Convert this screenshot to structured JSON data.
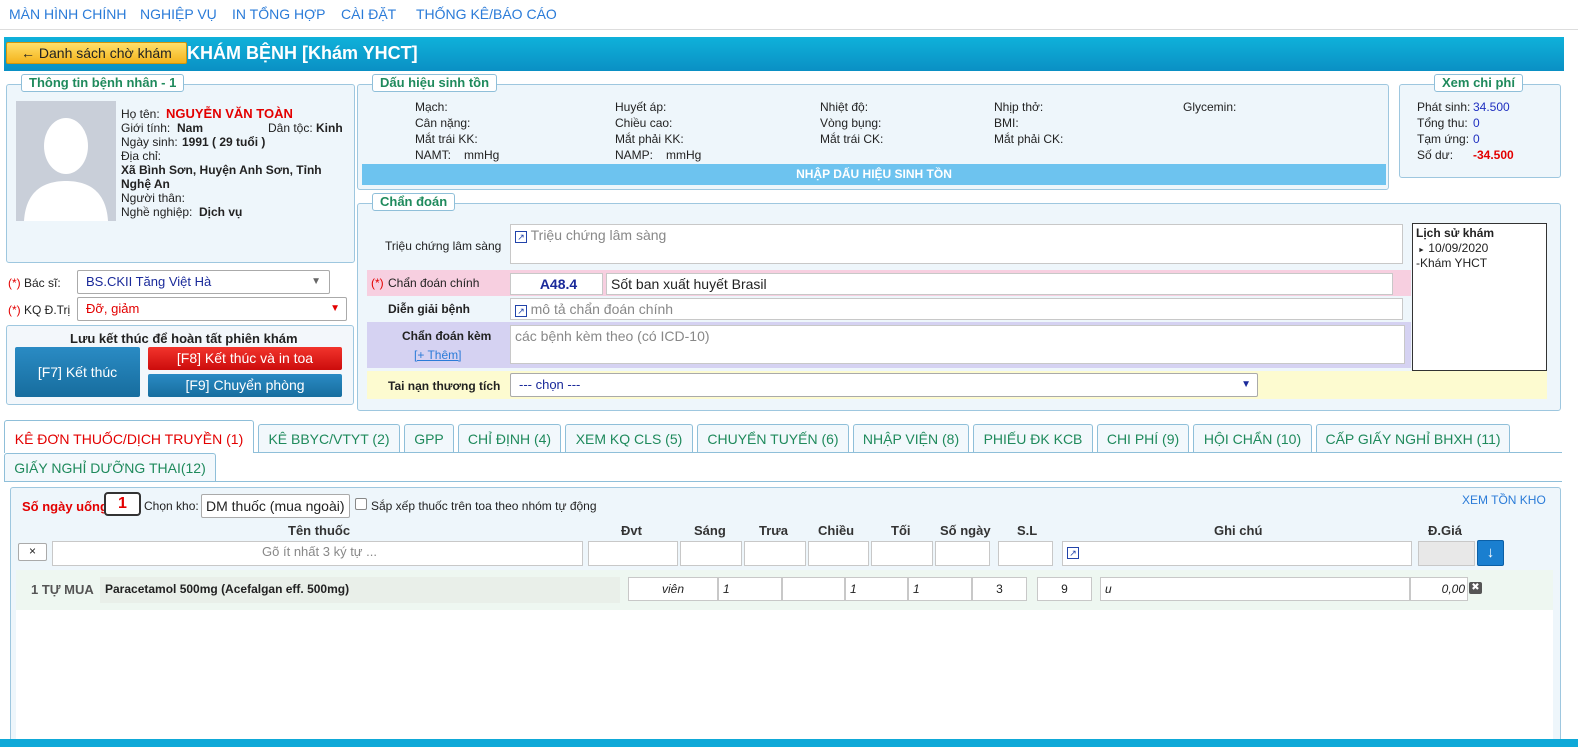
{
  "nav": [
    "MÀN HÌNH CHÍNH",
    "NGHIỆP VỤ",
    "IN TỔNG HỢP",
    "CÀI ĐẶT",
    "THỐNG KÊ/BÁO CÁO"
  ],
  "header": {
    "back_label": "← Danh sách chờ khám",
    "title": "KHÁM BỆNH [Khám YHCT]"
  },
  "patient": {
    "legend": "Thông tin bệnh nhân - 1",
    "name_label": "Họ tên:",
    "name": "NGUYỄN VĂN TOÀN",
    "gender_label": "Giới tính:",
    "gender": "Nam",
    "ethnic_label": "Dân tộc:",
    "ethnic": "Kinh",
    "dob_label": "Ngày sinh:",
    "dob": "1991 ( 29 tuổi )",
    "address_label": "Địa chỉ:",
    "address_line1": "Xã Bình Sơn, Huyện Anh Sơn, Tỉnh",
    "address_line2": "Nghệ An",
    "relative_label": "Người thân:",
    "job_label": "Nghề nghiệp:",
    "job": "Dịch vụ"
  },
  "doctor": {
    "required": "(*)",
    "label": "Bác sĩ:",
    "value": "BS.CKII Tăng Việt Hà"
  },
  "result": {
    "required": "(*)",
    "label": "KQ Đ.Trị",
    "value": "Đỡ, giảm"
  },
  "finish": {
    "title": "Lưu kết thúc để hoàn tất phiên khám",
    "f7": "[F7] Kết thúc",
    "f8": "[F8] Kết thúc và in toa",
    "f9": "[F9] Chuyển phòng"
  },
  "vitals": {
    "legend": "Dấu hiệu sinh tồn",
    "labels": [
      "Mạch:",
      "Huyết áp:",
      "Nhiệt độ:",
      "Nhịp thở:",
      "Glycemin:",
      "Cân nặng:",
      "Chiều cao:",
      "Vòng bụng:",
      "BMI:",
      "Mắt trái KK:",
      "Mắt phải KK:",
      "Mắt trái CK:",
      "Mắt phải CK:",
      "NAMT:",
      "mmHg",
      "NAMP:",
      "mmHg"
    ],
    "button": "NHẬP DẤU HIỆU SINH TỒN"
  },
  "fees": {
    "legend": "Xem chi phí",
    "incurred_label": "Phát sinh:",
    "incurred": "34.500",
    "total_label": "Tổng thu:",
    "total": "0",
    "advance_label": "Tạm ứng:",
    "advance": "0",
    "balance_label": "Số dư:",
    "balance": "-34.500"
  },
  "diagnosis": {
    "legend": "Chẩn đoán",
    "symptoms_label": "Triệu chứng lâm sàng",
    "symptoms_placeholder": "Triệu chứng lâm sàng",
    "main_required": "(*)",
    "main_label": "Chẩn đoán chính",
    "main_code": "A48.4",
    "main_name": "Sốt ban xuất huyết Brasil",
    "desc_label": "Diễn giải bệnh",
    "desc_placeholder": "mô tả chẩn đoán chính",
    "extra_label": "Chẩn đoán kèm",
    "extra_add": "[+ Thêm]",
    "extra_placeholder": "các bệnh kèm theo (có ICD-10)",
    "accident_label": "Tai nạn thương tích",
    "accident_value": "--- chọn ---",
    "history_title": "Lịch sử khám",
    "history_date": "10/09/2020",
    "history_item": "-Khám YHCT"
  },
  "tabs": [
    "KÊ ĐƠN THUỐC/DỊCH TRUYỀN (1)",
    "KÊ BBYC/VTYT (2)",
    "GPP",
    "CHỈ ĐỊNH (4)",
    "XEM KQ CLS (5)",
    "CHUYỂN TUYẾN (6)",
    "NHẬP VIỆN (8)",
    "PHIẾU ĐK KCB",
    "CHI PHÍ (9)",
    "HỘI CHẨN (10)",
    "CẤP GIẤY NGHỈ BHXH (11)",
    "GIẤY NGHỈ DƯỠNG THAI(12)"
  ],
  "prescription": {
    "days_label": "Số ngày uống",
    "days": "1",
    "store_label": "Chọn kho:",
    "store": "DM thuốc (mua ngoài)",
    "auto_sort_label": "Sắp xếp thuốc trên toa theo nhóm tự động",
    "stock_link": "XEM TỒN KHO",
    "columns": [
      "Tên thuốc",
      "Đvt",
      "Sáng",
      "Trưa",
      "Chiều",
      "Tối",
      "Số ngày",
      "S.L",
      "Ghi chú",
      "Đ.Giá"
    ],
    "search_placeholder": "Gõ ít nhất 3 ký tự ...",
    "clear_label": "×",
    "row": {
      "index": "1 TỰ MUA",
      "drug": "Paracetamol 500mg (Acefalgan eff. 500mg)",
      "unit": "viên",
      "morning": "1",
      "noon": "",
      "afternoon": "1",
      "night": "1",
      "days": "3",
      "qty": "9",
      "note": "u",
      "price": "0,00"
    }
  }
}
